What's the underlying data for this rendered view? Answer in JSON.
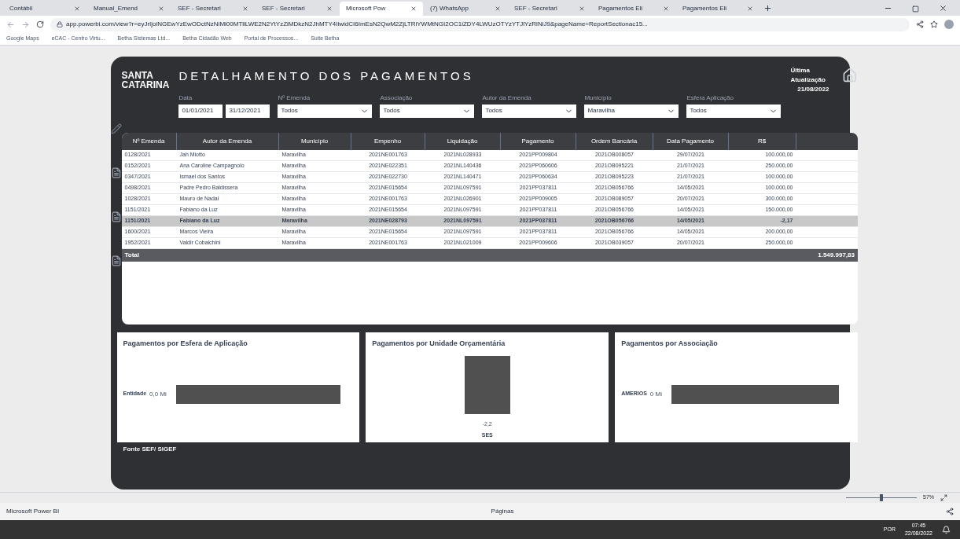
{
  "browser": {
    "tabs": [
      {
        "label": "Contábil",
        "selected": false
      },
      {
        "label": "Manual_Emend",
        "selected": false
      },
      {
        "label": "SEF - Secretari",
        "selected": false
      },
      {
        "label": "SEF - Secretari",
        "selected": false
      },
      {
        "label": "Microsoft Pow",
        "selected": true
      },
      {
        "label": "(7) WhatsApp",
        "selected": false
      },
      {
        "label": "SEF - Secretari",
        "selected": false
      },
      {
        "label": "Pagamentos Eli",
        "selected": false
      },
      {
        "label": "Pagamentos Eli",
        "selected": false
      }
    ],
    "url": "app.powerbi.com/view?r=eyJrIjoiNGEwYzEwODctNzNiMi00MTllLWE2N2YtYzZiMDkzN2JhMTY4IiwidCI6ImEsN2QwM2ZjLTRiYWMtNGI2OC1iZDY4LWUzOTYzYTJlYzRlNiJ9&pageName=ReportSectionac15...",
    "bookmarks": [
      "Google Maps",
      "eCAC - Centro Virtu...",
      "Betha Sistemas Ltd...",
      "Betha Cidadão Web",
      "Portal de Processos...",
      "Suite Betha"
    ]
  },
  "report": {
    "logo": {
      "line1": "SANTA",
      "line2": "CATARINA"
    },
    "title": "DETALHAMENTO DOS PAGAMENTOS",
    "update_label": "Última Atualização",
    "update_date": "21/08/2022",
    "filters": [
      {
        "kind": "dates",
        "label": "Data",
        "values": [
          "01/01/2021",
          "31/12/2021"
        ]
      },
      {
        "kind": "dropdown",
        "label": "Nº Emenda",
        "value": "Todos"
      },
      {
        "kind": "dropdown",
        "label": "Associação",
        "value": "Todos"
      },
      {
        "kind": "dropdown",
        "label": "Autor da Emenda",
        "value": "Todos"
      },
      {
        "kind": "dropdown",
        "label": "Município",
        "value": "Maravilha"
      },
      {
        "kind": "dropdown",
        "label": "Esfera Aplicação",
        "value": "Todos"
      }
    ],
    "table": {
      "columns": [
        "Nº Emenda",
        "Autor da Emenda",
        "Município",
        "Empenho",
        "Liquidação",
        "Pagamento",
        "Ordem Bancária",
        "Data Pagamento",
        "R$"
      ],
      "rows": [
        {
          "selected": false,
          "cells": [
            "0128/2021",
            "Jah Miotto",
            "Maravilha",
            "2021NE001763",
            "2021NL028933",
            "2021PP009804",
            "2021OB008057",
            "29/07/2021",
            "100.000,00"
          ]
        },
        {
          "selected": false,
          "cells": [
            "0152/2021",
            "Ana Caroline Campagnolo",
            "Maravilha",
            "2021NE022351",
            "2021NL140436",
            "2021PP060606",
            "2021OB095221",
            "21/07/2021",
            "250.000,00"
          ]
        },
        {
          "selected": false,
          "cells": [
            "0347/2021",
            "Ismael dos Santos",
            "Maravilha",
            "2021NE022730",
            "2021NL140471",
            "2021PP060634",
            "2021OB095223",
            "21/07/2021",
            "100.000,00"
          ]
        },
        {
          "selected": false,
          "cells": [
            "0498/2021",
            "Padre Pedro Baldissera",
            "Maravilha",
            "2021NE015654",
            "2021NL097591",
            "2021PP037811",
            "2021OB056766",
            "14/05/2021",
            "100.000,00"
          ]
        },
        {
          "selected": false,
          "cells": [
            "1028/2021",
            "Mauro de Nadal",
            "Maravilha",
            "2021NE001763",
            "2021NL026901",
            "2021PP009005",
            "2021OB089057",
            "20/07/2021",
            "300.000,00"
          ]
        },
        {
          "selected": false,
          "cells": [
            "1151/2021",
            "Fabiano da Luz",
            "Maravilha",
            "2021NE015654",
            "2021NL097591",
            "2021PP037811",
            "2021OB056766",
            "14/05/2021",
            "150.000,00"
          ]
        },
        {
          "selected": true,
          "cells": [
            "1151/2021",
            "Fabiano da Luz",
            "Maravilha",
            "2021NE028793",
            "2021NL097591",
            "2021PP037811",
            "2021OB056766",
            "14/05/2021",
            "-2,17"
          ]
        },
        {
          "selected": false,
          "cells": [
            "1600/2021",
            "Marcos Vieira",
            "Maravilha",
            "2021NE015654",
            "2021NL097591",
            "2021PP037811",
            "2021OB056766",
            "14/05/2021",
            "200.000,00"
          ]
        },
        {
          "selected": false,
          "cells": [
            "1952/2021",
            "Valdir Cobalchini",
            "Maravilha",
            "2021NE001763",
            "2021NL021009",
            "2021PP009606",
            "2021OB039057",
            "20/07/2021",
            "250.000,00"
          ]
        }
      ],
      "total_label": "Total",
      "total_value": "1.549.997,83"
    },
    "panels": [
      {
        "kind": "hbar",
        "title": "Pagamentos por Esfera de Aplicação",
        "category": "Entidade",
        "value_label": "0,0 Mi"
      },
      {
        "kind": "vbar",
        "title": "Pagamentos por Unidade Orçamentária",
        "category": "SES",
        "value_label": "-2,2"
      },
      {
        "kind": "hbar",
        "title": "Pagamentos por Associação",
        "category": "AMERIOS",
        "value_label": "0 Mi"
      }
    ],
    "source": "Fonte SEF/ SIGEF"
  },
  "powerbi_bar": {
    "zoom_slider": {
      "level": 0.5
    },
    "zoom": "57%",
    "app_name": "Microsoft Power BI",
    "pages": "Páginas"
  },
  "taskbar": {
    "language": "POR",
    "time": "07:45",
    "date": "22/08/2022"
  }
}
